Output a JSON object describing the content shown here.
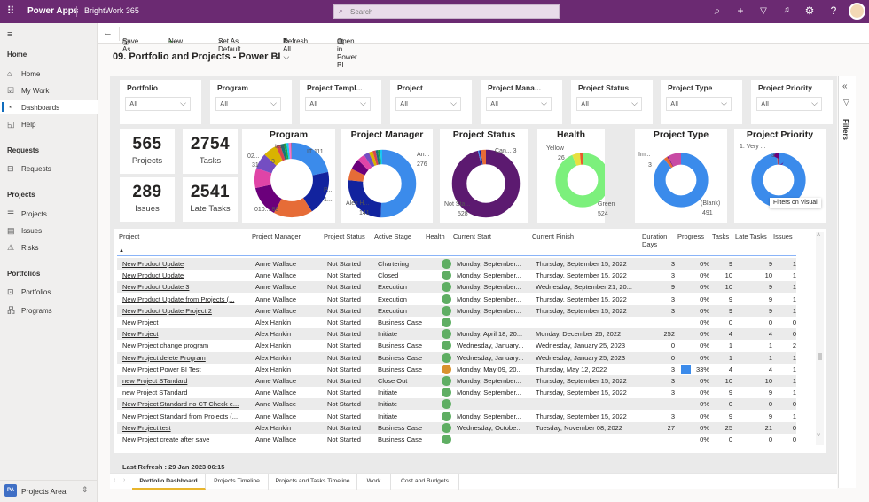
{
  "topbar": {
    "app_name": "Power Apps",
    "environment": "BrightWork 365",
    "search_placeholder": "Search",
    "icons": [
      "waffle-icon",
      "search-icon",
      "plus-icon",
      "filter-icon",
      "bell-icon",
      "gear-icon",
      "help-icon",
      "avatar"
    ]
  },
  "sidebar": {
    "sections": [
      {
        "title": "Home",
        "items": [
          {
            "label": "Home",
            "icon": "home-icon"
          },
          {
            "label": "My Work",
            "icon": "checkbox-icon"
          },
          {
            "label": "Dashboards",
            "icon": "pie-icon",
            "active": true
          },
          {
            "label": "Help",
            "icon": "help-icon"
          }
        ]
      },
      {
        "title": "Requests",
        "items": [
          {
            "label": "Requests",
            "icon": "inbox-icon"
          }
        ]
      },
      {
        "title": "Projects",
        "items": [
          {
            "label": "Projects",
            "icon": "projects-icon"
          },
          {
            "label": "Issues",
            "icon": "issues-icon"
          },
          {
            "label": "Risks",
            "icon": "warning-icon"
          }
        ]
      },
      {
        "title": "Portfolios",
        "items": [
          {
            "label": "Portfolios",
            "icon": "briefcase-icon"
          },
          {
            "label": "Programs",
            "icon": "hierarchy-icon"
          }
        ]
      }
    ],
    "area": {
      "badge": "PA",
      "label": "Projects Area"
    }
  },
  "toolbar": {
    "save_as": "Save As",
    "new": "New",
    "set_default": "Set As Default",
    "refresh_all": "Refresh All",
    "open_powerbi": "Open in Power BI"
  },
  "page_title": "09. Portfolio and Projects - Power BI",
  "slicers": [
    {
      "label": "Portfolio",
      "value": "All"
    },
    {
      "label": "Program",
      "value": "All"
    },
    {
      "label": "Project Templ...",
      "value": "All"
    },
    {
      "label": "Project",
      "value": "All"
    },
    {
      "label": "Project Mana...",
      "value": "All"
    },
    {
      "label": "Project Status",
      "value": "All"
    },
    {
      "label": "Project Type",
      "value": "All"
    },
    {
      "label": "Project Priority",
      "value": "All"
    }
  ],
  "kpis": [
    {
      "value": "565",
      "label": "Projects"
    },
    {
      "value": "2754",
      "label": "Tasks"
    },
    {
      "value": "289",
      "label": "Issues"
    },
    {
      "value": "2541",
      "label": "Late Tasks"
    }
  ],
  "filters_pane": {
    "label": "Filters",
    "tooltip": "Filters on Visual"
  },
  "donuts": [
    {
      "title": "Program",
      "labels": [
        {
          "text": "test"
        },
        {
          "text": "02..."
        },
        {
          "text": "31"
        },
        {
          "text": "3"
        },
        {
          "text": "IT 111"
        },
        {
          "text": "P..."
        },
        {
          "text": "1..."
        },
        {
          "text": "010... 88"
        }
      ],
      "slices": [
        {
          "value": 111,
          "color": "#3b8beb"
        },
        {
          "value": 100,
          "color": "#12239e"
        },
        {
          "value": 88,
          "color": "#e66c37"
        },
        {
          "value": 70,
          "color": "#6b007b"
        },
        {
          "value": 45,
          "color": "#e044a7"
        },
        {
          "value": 35,
          "color": "#744ec2"
        },
        {
          "value": 31,
          "color": "#d9b300"
        },
        {
          "value": 10,
          "color": "#d64550"
        },
        {
          "value": 8,
          "color": "#197278"
        },
        {
          "value": 6,
          "color": "#1aab40"
        },
        {
          "value": 5,
          "color": "#15c6f4"
        },
        {
          "value": 5,
          "color": "#f472d0"
        },
        {
          "value": 3,
          "color": "#a66999"
        }
      ]
    },
    {
      "title": "Project Manager",
      "labels": [
        {
          "text": "An..."
        },
        {
          "text": "276"
        },
        {
          "text": "Alex H..."
        },
        {
          "text": "141"
        }
      ],
      "slices": [
        {
          "value": 276,
          "color": "#3b8beb"
        },
        {
          "value": 141,
          "color": "#12239e"
        },
        {
          "value": 30,
          "color": "#e66c37"
        },
        {
          "value": 28,
          "color": "#6b007b"
        },
        {
          "value": 20,
          "color": "#e044a7"
        },
        {
          "value": 14,
          "color": "#744ec2"
        },
        {
          "value": 10,
          "color": "#d9b300"
        },
        {
          "value": 8,
          "color": "#d64550"
        },
        {
          "value": 6,
          "color": "#197278"
        },
        {
          "value": 6,
          "color": "#1aab40"
        },
        {
          "value": 6,
          "color": "#15c6f4"
        }
      ]
    },
    {
      "title": "Project Status",
      "labels": [
        {
          "text": "Can... 3"
        },
        {
          "text": "Not Sta..."
        },
        {
          "text": "528"
        }
      ],
      "slices": [
        {
          "value": 528,
          "color": "#5c1a70"
        },
        {
          "value": 3,
          "color": "#3b8beb"
        },
        {
          "value": 4,
          "color": "#12239e"
        },
        {
          "value": 15,
          "color": "#e66c37"
        }
      ]
    },
    {
      "title": "Health",
      "labels": [
        {
          "text": "Yellow"
        },
        {
          "text": "26"
        },
        {
          "text": "Green"
        },
        {
          "text": "524"
        }
      ],
      "slices": [
        {
          "value": 524,
          "color": "#7cf07c"
        },
        {
          "value": 26,
          "color": "#e8e040"
        },
        {
          "value": 10,
          "color": "#e85a2c"
        }
      ]
    },
    {
      "title": "Project Type",
      "labels": [
        {
          "text": "Im..."
        },
        {
          "text": "3"
        },
        {
          "text": "(Blank)"
        },
        {
          "text": "491"
        }
      ],
      "slices": [
        {
          "value": 491,
          "color": "#3b8beb"
        },
        {
          "value": 12,
          "color": "#e66c37"
        },
        {
          "value": 3,
          "color": "#6b007b"
        },
        {
          "value": 45,
          "color": "#c84aa4"
        }
      ]
    },
    {
      "title": "Project Priority",
      "labels": [
        {
          "text": "1. Very ..."
        },
        {
          "text": "3"
        }
      ],
      "slices": [
        {
          "value": 552,
          "color": "#3b8beb"
        },
        {
          "value": 3,
          "color": "#e66c37"
        },
        {
          "value": 3,
          "color": "#6b007b"
        }
      ]
    }
  ],
  "table": {
    "columns": [
      "Project",
      "Project Manager",
      "Project Status",
      "Active Stage",
      "Health",
      "Current Start",
      "Current Finish",
      "Duration Days",
      "Progress",
      "Tasks",
      "Late Tasks",
      "Issues"
    ],
    "health_colors": {
      "green": "#5fae63",
      "orange": "#d9922e"
    },
    "rows": [
      [
        "New Product Update",
        "Anne Wallace",
        "Not Started",
        "Chartering",
        "green",
        "Monday, September...",
        "Thursday, September 15, 2022",
        "3",
        "0%",
        "9",
        "9",
        "1"
      ],
      [
        "New Product Update",
        "Anne Wallace",
        "Not Started",
        "Closed",
        "green",
        "Monday, September...",
        "Thursday, September 15, 2022",
        "3",
        "0%",
        "10",
        "10",
        "1"
      ],
      [
        "New Product Update 3",
        "Anne Wallace",
        "Not Started",
        "Execution",
        "green",
        "Monday, September...",
        "Wednesday, September 21, 20...",
        "9",
        "0%",
        "10",
        "9",
        "1"
      ],
      [
        "New Product Update from Projects (...",
        "Anne Wallace",
        "Not Started",
        "Execution",
        "green",
        "Monday, September...",
        "Thursday, September 15, 2022",
        "3",
        "0%",
        "9",
        "9",
        "1"
      ],
      [
        "New Product Update Project 2",
        "Anne Wallace",
        "Not Started",
        "Execution",
        "green",
        "Monday, September...",
        "Thursday, September 15, 2022",
        "3",
        "0%",
        "9",
        "9",
        "1"
      ],
      [
        "New Project",
        "Alex Hankin",
        "Not Started",
        "Business Case",
        "green",
        "",
        "",
        "",
        "0%",
        "0",
        "0",
        "0"
      ],
      [
        "New Project",
        "Alex Hankin",
        "Not Started",
        "Initiate",
        "green",
        "Monday, April 18, 20...",
        "Monday, December 26, 2022",
        "252",
        "0%",
        "4",
        "4",
        "0"
      ],
      [
        "New Project change program",
        "Alex Hankin",
        "Not Started",
        "Business Case",
        "green",
        "Wednesday, January...",
        "Wednesday, January 25, 2023",
        "0",
        "0%",
        "1",
        "1",
        "2"
      ],
      [
        "New Project delete Program",
        "Alex Hankin",
        "Not Started",
        "Business Case",
        "green",
        "Wednesday, January...",
        "Wednesday, January 25, 2023",
        "0",
        "0%",
        "1",
        "1",
        "1"
      ],
      [
        "New Project Power BI Test",
        "Alex Hankin",
        "Not Started",
        "Business Case",
        "orange",
        "Monday, May 09, 20...",
        "Thursday, May 12, 2022",
        "3",
        "33%",
        "4",
        "4",
        "1"
      ],
      [
        "new Project STandard",
        "Anne Wallace",
        "Not Started",
        "Close Out",
        "green",
        "Monday, September...",
        "Thursday, September 15, 2022",
        "3",
        "0%",
        "10",
        "10",
        "1"
      ],
      [
        "new Project STandard",
        "Anne Wallace",
        "Not Started",
        "Initiate",
        "green",
        "Monday, September...",
        "Thursday, September 15, 2022",
        "3",
        "0%",
        "9",
        "9",
        "1"
      ],
      [
        "New Project Standard  no CT Check e...",
        "Anne Wallace",
        "Not Started",
        "Initiate",
        "green",
        "",
        "",
        "",
        "0%",
        "0",
        "0",
        "0"
      ],
      [
        "New Project Standard from Projects (...",
        "Anne Wallace",
        "Not Started",
        "Initiate",
        "green",
        "Monday, September...",
        "Thursday, September 15, 2022",
        "3",
        "0%",
        "9",
        "9",
        "1"
      ],
      [
        "New Project test",
        "Alex Hankin",
        "Not Started",
        "Business Case",
        "green",
        "Wednesday, Octobe...",
        "Tuesday, November 08, 2022",
        "27",
        "0%",
        "25",
        "21",
        "0"
      ],
      [
        "New Project  create after save",
        "Anne Wallace",
        "Not Started",
        "Business Case",
        "green",
        "",
        "",
        "",
        "0%",
        "0",
        "0",
        "0"
      ]
    ]
  },
  "last_refresh": "Last Refresh :  29 Jan 2023 06:15",
  "report_tabs": [
    {
      "label": "Portfolio Dashboard",
      "active": true
    },
    {
      "label": "Projects Timeline"
    },
    {
      "label": "Projects and Tasks Timeline"
    },
    {
      "label": "Work"
    },
    {
      "label": "Cost and Budgets"
    }
  ]
}
